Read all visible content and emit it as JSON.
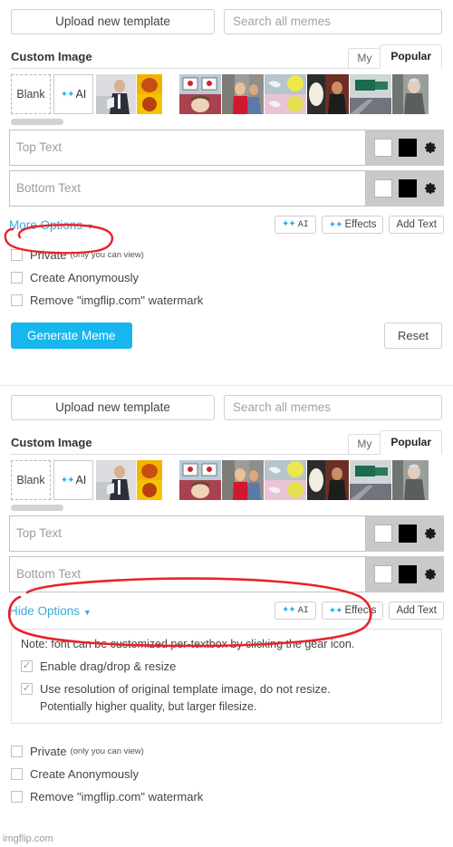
{
  "panels": [
    {
      "upload_label": "Upload new template",
      "search_placeholder": "Search all memes",
      "section_title": "Custom Image",
      "tabs": [
        {
          "label": "My",
          "active": false
        },
        {
          "label": "Popular",
          "active": true
        }
      ],
      "thumbs": {
        "blank_label": "Blank",
        "ai_label": "AI"
      },
      "top_text_placeholder": "Top Text",
      "bottom_text_placeholder": "Bottom Text",
      "options_toggle": "More Options",
      "caret": "▼",
      "mini_buttons": [
        "AI",
        "Effects",
        "Add Text"
      ],
      "expanded": false,
      "checkboxes": [
        {
          "label": "Private",
          "hint": "(only you can view)",
          "checked": false
        },
        {
          "label": "Create Anonymously",
          "hint": "",
          "checked": false
        },
        {
          "label": "Remove \"imgflip.com\" watermark",
          "hint": "",
          "checked": false
        }
      ],
      "generate_label": "Generate Meme",
      "reset_label": "Reset"
    },
    {
      "upload_label": "Upload new template",
      "search_placeholder": "Search all memes",
      "section_title": "Custom Image",
      "tabs": [
        {
          "label": "My",
          "active": false
        },
        {
          "label": "Popular",
          "active": true
        }
      ],
      "thumbs": {
        "blank_label": "Blank",
        "ai_label": "AI"
      },
      "top_text_placeholder": "Top Text",
      "bottom_text_placeholder": "Bottom Text",
      "options_toggle": "Hide Options",
      "caret": "▼",
      "mini_buttons": [
        "AI",
        "Effects",
        "Add Text"
      ],
      "expanded": true,
      "note": {
        "text": "Note: font can be customized per-textbox by clicking the gear icon.",
        "options": [
          {
            "label": "Enable drag/drop & resize",
            "checked": true,
            "sub": ""
          },
          {
            "label": "Use resolution of original template image, do not resize.",
            "checked": true,
            "sub": "Potentially higher quality, but larger filesize."
          }
        ]
      },
      "checkboxes": [
        {
          "label": "Private",
          "hint": "(only you can view)",
          "checked": false
        },
        {
          "label": "Create Anonymously",
          "hint": "",
          "checked": false
        },
        {
          "label": "Remove \"imgflip.com\" watermark",
          "hint": "",
          "checked": false
        }
      ]
    }
  ],
  "watermark": "imgflip.com",
  "annotation_color": "#e8232a",
  "accent_color": "#17b6ee",
  "link_color": "#3aa9d8"
}
